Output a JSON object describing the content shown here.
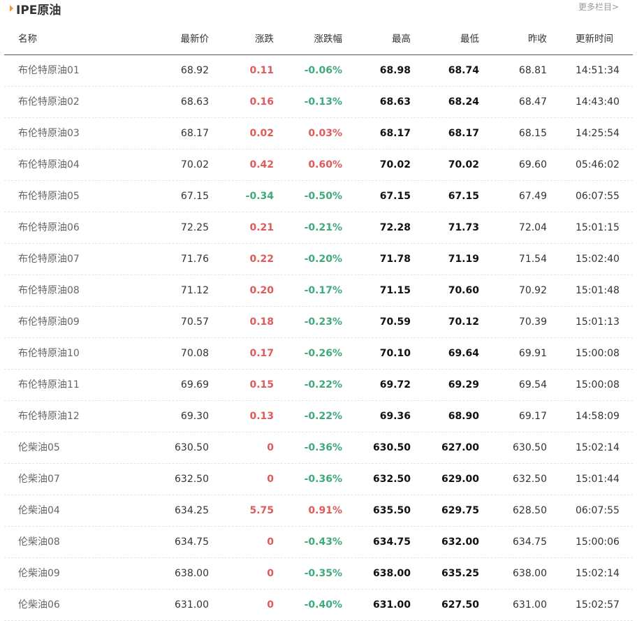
{
  "header": {
    "title": "IPE原油",
    "more_label": "更多栏目>"
  },
  "colors": {
    "up": "#e05a5a",
    "down": "#3faa7a",
    "accent": "#f39a3a"
  },
  "table": {
    "columns": [
      "名称",
      "最新价",
      "涨跌",
      "涨跌幅",
      "最高",
      "最低",
      "昨收",
      "更新时间"
    ],
    "rows": [
      {
        "name": "布伦特原油01",
        "last": "68.92",
        "chg": "0.11",
        "pct": "-0.06%",
        "high": "68.98",
        "low": "68.74",
        "prev": "68.81",
        "time": "14:51:34",
        "chg_dir": "up",
        "pct_dir": "down"
      },
      {
        "name": "布伦特原油02",
        "last": "68.63",
        "chg": "0.16",
        "pct": "-0.13%",
        "high": "68.63",
        "low": "68.24",
        "prev": "68.47",
        "time": "14:43:40",
        "chg_dir": "up",
        "pct_dir": "down"
      },
      {
        "name": "布伦特原油03",
        "last": "68.17",
        "chg": "0.02",
        "pct": "0.03%",
        "high": "68.17",
        "low": "68.17",
        "prev": "68.15",
        "time": "14:25:54",
        "chg_dir": "up",
        "pct_dir": "up"
      },
      {
        "name": "布伦特原油04",
        "last": "70.02",
        "chg": "0.42",
        "pct": "0.60%",
        "high": "70.02",
        "low": "70.02",
        "prev": "69.60",
        "time": "05:46:02",
        "chg_dir": "up",
        "pct_dir": "up"
      },
      {
        "name": "布伦特原油05",
        "last": "67.15",
        "chg": "-0.34",
        "pct": "-0.50%",
        "high": "67.15",
        "low": "67.15",
        "prev": "67.49",
        "time": "06:07:55",
        "chg_dir": "down",
        "pct_dir": "down"
      },
      {
        "name": "布伦特原油06",
        "last": "72.25",
        "chg": "0.21",
        "pct": "-0.21%",
        "high": "72.28",
        "low": "71.73",
        "prev": "72.04",
        "time": "15:01:15",
        "chg_dir": "up",
        "pct_dir": "down"
      },
      {
        "name": "布伦特原油07",
        "last": "71.76",
        "chg": "0.22",
        "pct": "-0.20%",
        "high": "71.78",
        "low": "71.19",
        "prev": "71.54",
        "time": "15:02:40",
        "chg_dir": "up",
        "pct_dir": "down"
      },
      {
        "name": "布伦特原油08",
        "last": "71.12",
        "chg": "0.20",
        "pct": "-0.17%",
        "high": "71.15",
        "low": "70.60",
        "prev": "70.92",
        "time": "15:01:48",
        "chg_dir": "up",
        "pct_dir": "down"
      },
      {
        "name": "布伦特原油09",
        "last": "70.57",
        "chg": "0.18",
        "pct": "-0.23%",
        "high": "70.59",
        "low": "70.12",
        "prev": "70.39",
        "time": "15:01:13",
        "chg_dir": "up",
        "pct_dir": "down"
      },
      {
        "name": "布伦特原油10",
        "last": "70.08",
        "chg": "0.17",
        "pct": "-0.26%",
        "high": "70.10",
        "low": "69.64",
        "prev": "69.91",
        "time": "15:00:08",
        "chg_dir": "up",
        "pct_dir": "down"
      },
      {
        "name": "布伦特原油11",
        "last": "69.69",
        "chg": "0.15",
        "pct": "-0.22%",
        "high": "69.72",
        "low": "69.29",
        "prev": "69.54",
        "time": "15:00:08",
        "chg_dir": "up",
        "pct_dir": "down"
      },
      {
        "name": "布伦特原油12",
        "last": "69.30",
        "chg": "0.13",
        "pct": "-0.22%",
        "high": "69.36",
        "low": "68.90",
        "prev": "69.17",
        "time": "14:58:09",
        "chg_dir": "up",
        "pct_dir": "down"
      },
      {
        "name": "伦柴油05",
        "last": "630.50",
        "chg": "0",
        "pct": "-0.36%",
        "high": "630.50",
        "low": "627.00",
        "prev": "630.50",
        "time": "15:02:14",
        "chg_dir": "up",
        "pct_dir": "down"
      },
      {
        "name": "伦柴油07",
        "last": "632.50",
        "chg": "0",
        "pct": "-0.36%",
        "high": "632.50",
        "low": "629.00",
        "prev": "632.50",
        "time": "15:01:44",
        "chg_dir": "up",
        "pct_dir": "down"
      },
      {
        "name": "伦柴油04",
        "last": "634.25",
        "chg": "5.75",
        "pct": "0.91%",
        "high": "635.50",
        "low": "629.75",
        "prev": "628.50",
        "time": "06:07:55",
        "chg_dir": "up",
        "pct_dir": "up"
      },
      {
        "name": "伦柴油08",
        "last": "634.75",
        "chg": "0",
        "pct": "-0.43%",
        "high": "634.75",
        "low": "632.00",
        "prev": "634.75",
        "time": "15:00:06",
        "chg_dir": "up",
        "pct_dir": "down"
      },
      {
        "name": "伦柴油09",
        "last": "638.00",
        "chg": "0",
        "pct": "-0.35%",
        "high": "638.00",
        "low": "635.25",
        "prev": "638.00",
        "time": "15:02:14",
        "chg_dir": "up",
        "pct_dir": "down"
      },
      {
        "name": "伦柴油06",
        "last": "631.00",
        "chg": "0",
        "pct": "-0.40%",
        "high": "631.00",
        "low": "627.50",
        "prev": "631.00",
        "time": "15:02:57",
        "chg_dir": "up",
        "pct_dir": "down"
      }
    ]
  }
}
